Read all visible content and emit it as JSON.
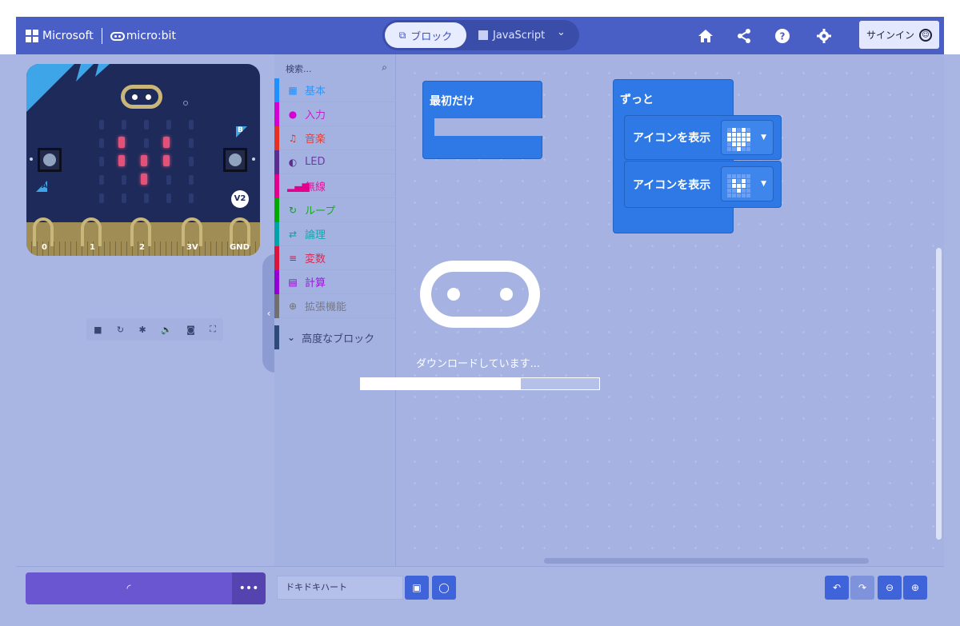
{
  "header": {
    "brand": "Microsoft",
    "product": "micro:bit",
    "mode_blocks": "ブロック",
    "mode_js": "JavaScript",
    "signin": "サインイン"
  },
  "toolbox": {
    "search_placeholder": "検索...",
    "categories": [
      {
        "label": "基本",
        "icon": "grid-icon",
        "color": "#1e90ff",
        "glyph": "▦"
      },
      {
        "label": "入力",
        "icon": "input-icon",
        "color": "#d400d4",
        "glyph": "●"
      },
      {
        "label": "音楽",
        "icon": "headphones-icon",
        "color": "#e63022",
        "glyph": "♫"
      },
      {
        "label": "LED",
        "icon": "toggle-icon",
        "color": "#5c2d91",
        "glyph": "◐"
      },
      {
        "label": "無線",
        "icon": "signal-icon",
        "color": "#e3008c",
        "glyph": "▂▄▆"
      },
      {
        "label": "ループ",
        "icon": "loop-icon",
        "color": "#00aa00",
        "glyph": "↻"
      },
      {
        "label": "論理",
        "icon": "shuffle-icon",
        "color": "#00a4a6",
        "glyph": "⇄"
      },
      {
        "label": "変数",
        "icon": "list-icon",
        "color": "#dc143c",
        "glyph": "≡"
      },
      {
        "label": "計算",
        "icon": "calculator-icon",
        "color": "#9400d3",
        "glyph": "▤"
      },
      {
        "label": "拡張機能",
        "icon": "plus-circle-icon",
        "color": "#707070",
        "glyph": "⊕"
      }
    ],
    "advanced": "高度なブロック"
  },
  "workspace": {
    "on_start": "最初だけ",
    "forever": "ずっと",
    "show_icon_1": "アイコンを表示",
    "show_icon_2": "アイコンを表示",
    "download_text": "ダウンロードしています...",
    "progress": 0.67
  },
  "simulator": {
    "pins": [
      "0",
      "1",
      "2",
      "3V",
      "GND"
    ],
    "button_a": "A",
    "button_b": "B",
    "version": "V2"
  },
  "bottom": {
    "project_name": "ドキドキハート",
    "more": "•••"
  },
  "colors": {
    "header": "#4a5fc6",
    "block": "#2f79e6",
    "download": "#6a56d0"
  }
}
